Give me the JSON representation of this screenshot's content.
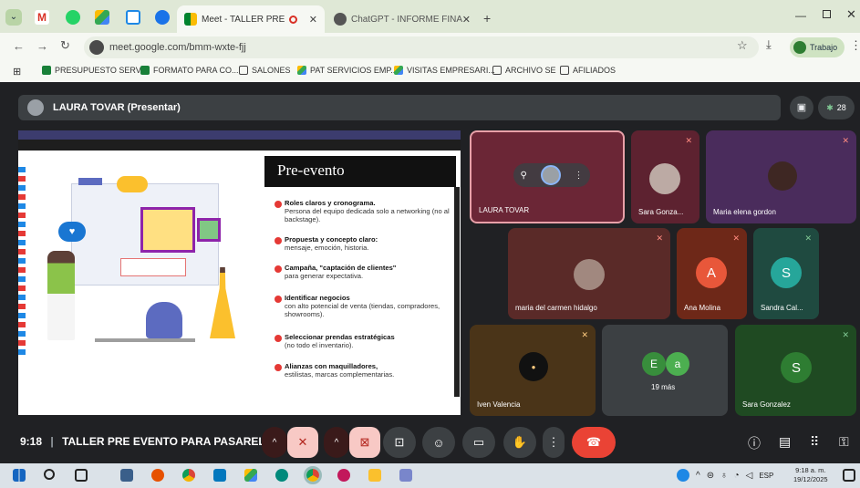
{
  "browser": {
    "tabs": [
      {
        "label": "Meet - TALLER PRE EVENTO",
        "active": true
      },
      {
        "label": "ChatGPT - INFORME FINANCIE",
        "active": false
      }
    ],
    "url": "meet.google.com/bmm-wxte-fjj",
    "profile_label": "Trabajo",
    "bookmarks": [
      "PRESUPUESTO SERV...",
      "FORMATO PARA CO...",
      "SALONES",
      "PAT SERVICIOS EMP...",
      "VISITAS EMPRESARI...",
      "ARCHIVO SE",
      "AFILIADOS"
    ]
  },
  "meet": {
    "presenter_label": "LAURA TOVAR (Presentar)",
    "participant_count": "28",
    "slide": {
      "title": "Pre-evento",
      "items": [
        {
          "bold": "Roles claros y cronograma.",
          "text": "Persona del equipo dedicada solo a networking (no al backstage)."
        },
        {
          "bold": "Propuesta y concepto claro:",
          "text": "mensaje, emoción, historia."
        },
        {
          "bold": "Campaña, \"captación de clientes\"",
          "text": "para generar expectativa."
        },
        {
          "bold": "Identificar negocios",
          "text": "con alto potencial de venta (tiendas, compradores, showrooms)."
        },
        {
          "bold": "Seleccionar prendas estratégicas",
          "text": "(no todo el inventario)."
        },
        {
          "bold": "Alianzas con maquilladores,",
          "text": "estilistas, marcas complementarias."
        }
      ]
    },
    "tiles": [
      {
        "name": "LAURA TOVAR"
      },
      {
        "name": "Sara Gonza..."
      },
      {
        "name": "Maria elena gordon"
      },
      {
        "name": "maria del carmen hidalgo"
      },
      {
        "name": "Ana Molina",
        "initial": "A"
      },
      {
        "name": "Sandra Cal...",
        "initial": "S"
      },
      {
        "name": "Iven Valencia"
      },
      {
        "name": "19 más",
        "initials": [
          "E",
          "a"
        ]
      },
      {
        "name": "Sara Gonzalez",
        "initial": "S"
      }
    ],
    "time": "9:18",
    "meeting_title": "TALLER PRE EVENTO PARA PASARELA"
  },
  "taskbar": {
    "lang": "ESP",
    "clock_time": "9:18 a. m.",
    "clock_date": "19/12/2025"
  },
  "colors": {
    "meet_bg": "#202124",
    "end_call": "#ea4335",
    "active_tile": "#6b2636",
    "chrome_tab_bg": "#dfe8d6"
  }
}
